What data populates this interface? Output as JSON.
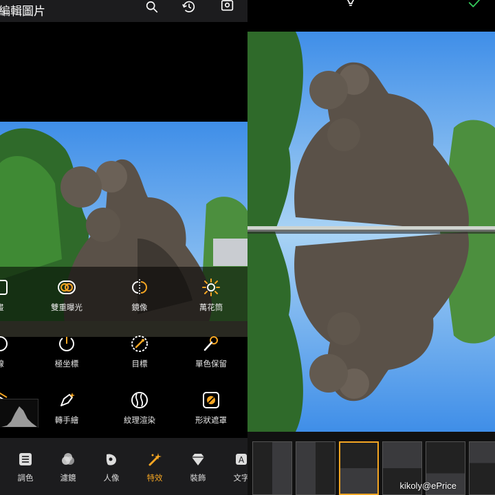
{
  "left": {
    "title": "編輯圖片",
    "header_icons": [
      "search-icon",
      "history-icon",
      "save-icon"
    ],
    "effects": [
      {
        "label": "畫",
        "icon": "square-frame-icon"
      },
      {
        "label": "雙重曝光",
        "icon": "double-exposure-icon"
      },
      {
        "label": "鏡像",
        "icon": "mirror-icon"
      },
      {
        "label": "萬花筒",
        "icon": "kaleidoscope-icon"
      },
      {
        "label": "線",
        "icon": "circle-edge-icon"
      },
      {
        "label": "極坐標",
        "icon": "polar-coordinates-icon"
      },
      {
        "label": "目標",
        "icon": "target-icon"
      },
      {
        "label": "單色保留",
        "icon": "color-pick-icon"
      },
      {
        "label": "影",
        "icon": "layers-icon"
      },
      {
        "label": "轉手繪",
        "icon": "hand-drawn-icon"
      },
      {
        "label": "紋理渲染",
        "icon": "texture-icon"
      },
      {
        "label": "形狀遮罩",
        "icon": "shape-mask-icon"
      }
    ],
    "nav": [
      {
        "label": "調色",
        "icon": "adjust-icon",
        "active": false
      },
      {
        "label": "濾鏡",
        "icon": "filter-icon",
        "active": false
      },
      {
        "label": "人像",
        "icon": "portrait-icon",
        "active": false
      },
      {
        "label": "特效",
        "icon": "effects-icon",
        "active": true
      },
      {
        "label": "裝飾",
        "icon": "diamond-icon",
        "active": false
      },
      {
        "label": "文字",
        "icon": "text-icon",
        "active": false
      }
    ]
  },
  "right": {
    "header_icons": [
      "bulb-icon",
      "confirm-check-icon"
    ],
    "watermark": "kikoly@ePrice",
    "thumbnails": 6
  },
  "colors": {
    "accent": "#f5a623",
    "confirm": "#34c759",
    "panel": "#1c1c1e"
  }
}
